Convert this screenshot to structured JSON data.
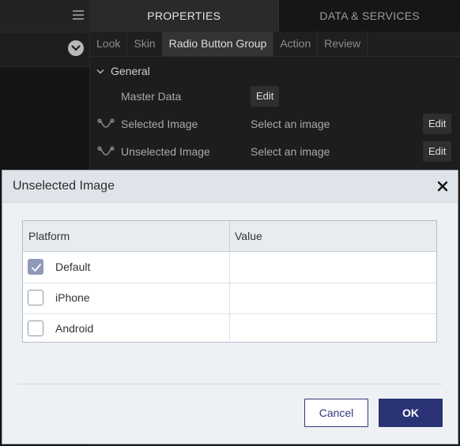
{
  "panel": {
    "tabs": [
      {
        "label": "PROPERTIES",
        "active": true
      },
      {
        "label": "DATA & SERVICES",
        "active": false
      }
    ],
    "subtabs": [
      {
        "label": "Look"
      },
      {
        "label": "Skin"
      },
      {
        "label": "Radio Button Group",
        "active": true
      },
      {
        "label": "Action"
      },
      {
        "label": "Review"
      }
    ],
    "section_label": "General",
    "properties": [
      {
        "label": "Master Data",
        "value": "",
        "button": "Edit"
      },
      {
        "label": "Selected Image",
        "value": "Select an image",
        "button": "Edit"
      },
      {
        "label": "Unselected Image",
        "value": "Select an image",
        "button": "Edit"
      }
    ]
  },
  "dialog": {
    "title": "Unselected Image",
    "columns": [
      "Platform",
      "Value"
    ],
    "rows": [
      {
        "platform": "Default",
        "checked": true,
        "value": ""
      },
      {
        "platform": "iPhone",
        "checked": false,
        "value": ""
      },
      {
        "platform": "Android",
        "checked": false,
        "value": ""
      }
    ],
    "cancel_label": "Cancel",
    "ok_label": "OK"
  },
  "colors": {
    "primary_button": "#2a3375",
    "checkbox_checked": "#8f99b8",
    "dialog_background": "#eef1f4",
    "ide_background": "#1d1d1d"
  }
}
